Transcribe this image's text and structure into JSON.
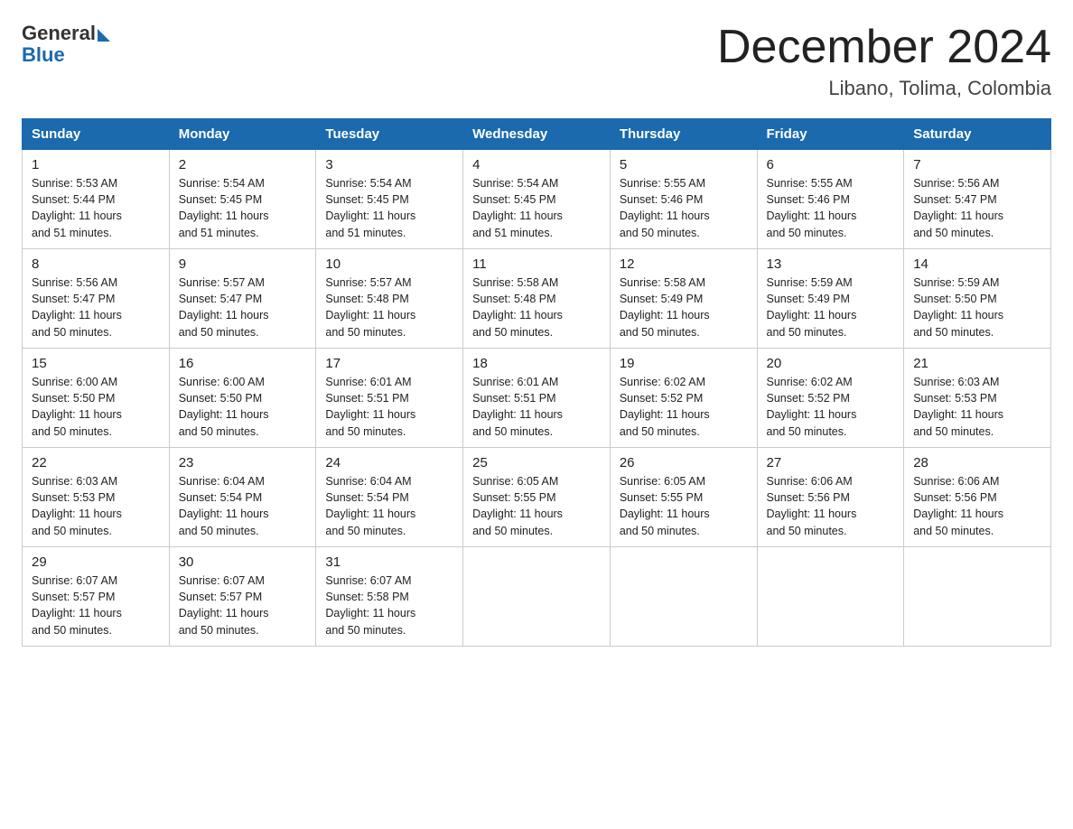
{
  "logo": {
    "general": "General",
    "blue": "Blue"
  },
  "header": {
    "title": "December 2024",
    "subtitle": "Libano, Tolima, Colombia"
  },
  "weekdays": [
    "Sunday",
    "Monday",
    "Tuesday",
    "Wednesday",
    "Thursday",
    "Friday",
    "Saturday"
  ],
  "weeks": [
    [
      {
        "day": "1",
        "sunrise": "5:53 AM",
        "sunset": "5:44 PM",
        "daylight": "11 hours and 51 minutes."
      },
      {
        "day": "2",
        "sunrise": "5:54 AM",
        "sunset": "5:45 PM",
        "daylight": "11 hours and 51 minutes."
      },
      {
        "day": "3",
        "sunrise": "5:54 AM",
        "sunset": "5:45 PM",
        "daylight": "11 hours and 51 minutes."
      },
      {
        "day": "4",
        "sunrise": "5:54 AM",
        "sunset": "5:45 PM",
        "daylight": "11 hours and 51 minutes."
      },
      {
        "day": "5",
        "sunrise": "5:55 AM",
        "sunset": "5:46 PM",
        "daylight": "11 hours and 50 minutes."
      },
      {
        "day": "6",
        "sunrise": "5:55 AM",
        "sunset": "5:46 PM",
        "daylight": "11 hours and 50 minutes."
      },
      {
        "day": "7",
        "sunrise": "5:56 AM",
        "sunset": "5:47 PM",
        "daylight": "11 hours and 50 minutes."
      }
    ],
    [
      {
        "day": "8",
        "sunrise": "5:56 AM",
        "sunset": "5:47 PM",
        "daylight": "11 hours and 50 minutes."
      },
      {
        "day": "9",
        "sunrise": "5:57 AM",
        "sunset": "5:47 PM",
        "daylight": "11 hours and 50 minutes."
      },
      {
        "day": "10",
        "sunrise": "5:57 AM",
        "sunset": "5:48 PM",
        "daylight": "11 hours and 50 minutes."
      },
      {
        "day": "11",
        "sunrise": "5:58 AM",
        "sunset": "5:48 PM",
        "daylight": "11 hours and 50 minutes."
      },
      {
        "day": "12",
        "sunrise": "5:58 AM",
        "sunset": "5:49 PM",
        "daylight": "11 hours and 50 minutes."
      },
      {
        "day": "13",
        "sunrise": "5:59 AM",
        "sunset": "5:49 PM",
        "daylight": "11 hours and 50 minutes."
      },
      {
        "day": "14",
        "sunrise": "5:59 AM",
        "sunset": "5:50 PM",
        "daylight": "11 hours and 50 minutes."
      }
    ],
    [
      {
        "day": "15",
        "sunrise": "6:00 AM",
        "sunset": "5:50 PM",
        "daylight": "11 hours and 50 minutes."
      },
      {
        "day": "16",
        "sunrise": "6:00 AM",
        "sunset": "5:50 PM",
        "daylight": "11 hours and 50 minutes."
      },
      {
        "day": "17",
        "sunrise": "6:01 AM",
        "sunset": "5:51 PM",
        "daylight": "11 hours and 50 minutes."
      },
      {
        "day": "18",
        "sunrise": "6:01 AM",
        "sunset": "5:51 PM",
        "daylight": "11 hours and 50 minutes."
      },
      {
        "day": "19",
        "sunrise": "6:02 AM",
        "sunset": "5:52 PM",
        "daylight": "11 hours and 50 minutes."
      },
      {
        "day": "20",
        "sunrise": "6:02 AM",
        "sunset": "5:52 PM",
        "daylight": "11 hours and 50 minutes."
      },
      {
        "day": "21",
        "sunrise": "6:03 AM",
        "sunset": "5:53 PM",
        "daylight": "11 hours and 50 minutes."
      }
    ],
    [
      {
        "day": "22",
        "sunrise": "6:03 AM",
        "sunset": "5:53 PM",
        "daylight": "11 hours and 50 minutes."
      },
      {
        "day": "23",
        "sunrise": "6:04 AM",
        "sunset": "5:54 PM",
        "daylight": "11 hours and 50 minutes."
      },
      {
        "day": "24",
        "sunrise": "6:04 AM",
        "sunset": "5:54 PM",
        "daylight": "11 hours and 50 minutes."
      },
      {
        "day": "25",
        "sunrise": "6:05 AM",
        "sunset": "5:55 PM",
        "daylight": "11 hours and 50 minutes."
      },
      {
        "day": "26",
        "sunrise": "6:05 AM",
        "sunset": "5:55 PM",
        "daylight": "11 hours and 50 minutes."
      },
      {
        "day": "27",
        "sunrise": "6:06 AM",
        "sunset": "5:56 PM",
        "daylight": "11 hours and 50 minutes."
      },
      {
        "day": "28",
        "sunrise": "6:06 AM",
        "sunset": "5:56 PM",
        "daylight": "11 hours and 50 minutes."
      }
    ],
    [
      {
        "day": "29",
        "sunrise": "6:07 AM",
        "sunset": "5:57 PM",
        "daylight": "11 hours and 50 minutes."
      },
      {
        "day": "30",
        "sunrise": "6:07 AM",
        "sunset": "5:57 PM",
        "daylight": "11 hours and 50 minutes."
      },
      {
        "day": "31",
        "sunrise": "6:07 AM",
        "sunset": "5:58 PM",
        "daylight": "11 hours and 50 minutes."
      },
      null,
      null,
      null,
      null
    ]
  ],
  "labels": {
    "sunrise": "Sunrise:",
    "sunset": "Sunset:",
    "daylight": "Daylight:"
  }
}
